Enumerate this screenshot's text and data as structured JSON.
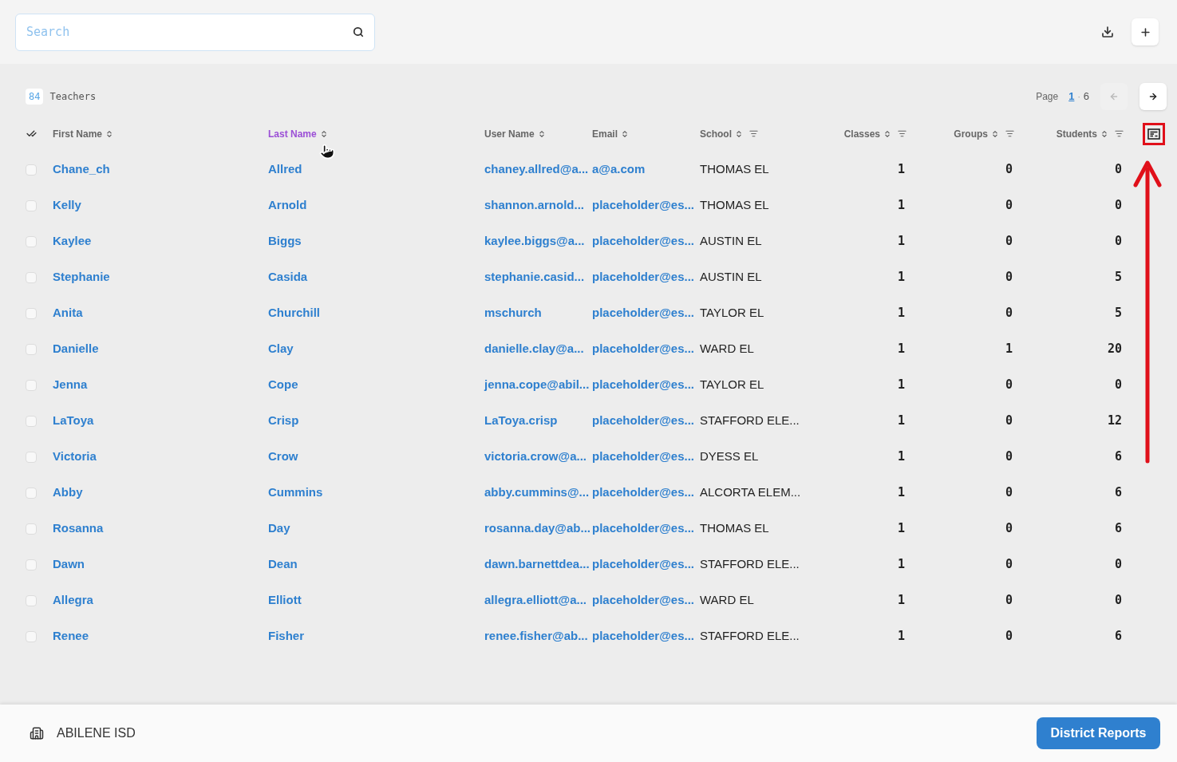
{
  "search": {
    "placeholder": "Search"
  },
  "summary": {
    "count": "84",
    "label": "Teachers"
  },
  "pagination": {
    "label": "Page",
    "current": "1",
    "separator": "·",
    "total": "6",
    "prev_disabled": true,
    "next_disabled": false
  },
  "columns": [
    {
      "label": "First Name",
      "kind": "text",
      "sortable": true,
      "filterable": false,
      "active": false
    },
    {
      "label": "Last Name",
      "kind": "text",
      "sortable": true,
      "filterable": false,
      "active": true
    },
    {
      "label": "User Name",
      "kind": "text",
      "sortable": true,
      "filterable": false,
      "active": false
    },
    {
      "label": "Email",
      "kind": "text",
      "sortable": true,
      "filterable": false,
      "active": false
    },
    {
      "label": "School",
      "kind": "plain",
      "sortable": true,
      "filterable": true,
      "active": false
    },
    {
      "label": "Classes",
      "kind": "number",
      "sortable": true,
      "filterable": true,
      "active": false
    },
    {
      "label": "Groups",
      "kind": "number",
      "sortable": true,
      "filterable": true,
      "active": false
    },
    {
      "label": "Students",
      "kind": "number",
      "sortable": true,
      "filterable": true,
      "active": false
    }
  ],
  "rows": [
    {
      "selected": false,
      "cells": [
        "Chane_ch",
        "Allred",
        "chaney.allred@a...",
        "a@a.com",
        "THOMAS EL",
        "1",
        "0",
        "0"
      ]
    },
    {
      "selected": false,
      "cells": [
        "Kelly",
        "Arnold",
        "shannon.arnold...",
        "placeholder@es...",
        "THOMAS EL",
        "1",
        "0",
        "0"
      ]
    },
    {
      "selected": false,
      "cells": [
        "Kaylee",
        "Biggs",
        "kaylee.biggs@a...",
        "placeholder@es...",
        "AUSTIN EL",
        "1",
        "0",
        "0"
      ]
    },
    {
      "selected": false,
      "cells": [
        "Stephanie",
        "Casida",
        "stephanie.casid...",
        "placeholder@es...",
        "AUSTIN EL",
        "1",
        "0",
        "5"
      ]
    },
    {
      "selected": false,
      "cells": [
        "Anita",
        "Churchill",
        "mschurch",
        "placeholder@es...",
        "TAYLOR EL",
        "1",
        "0",
        "5"
      ]
    },
    {
      "selected": false,
      "cells": [
        "Danielle",
        "Clay",
        "danielle.clay@a...",
        "placeholder@es...",
        "WARD EL",
        "1",
        "1",
        "20"
      ]
    },
    {
      "selected": false,
      "cells": [
        "Jenna",
        "Cope",
        "jenna.cope@abil...",
        "placeholder@es...",
        "TAYLOR EL",
        "1",
        "0",
        "0"
      ]
    },
    {
      "selected": false,
      "cells": [
        "LaToya",
        "Crisp",
        "LaToya.crisp",
        "placeholder@es...",
        "STAFFORD ELE...",
        "1",
        "0",
        "12"
      ]
    },
    {
      "selected": false,
      "cells": [
        "Victoria",
        "Crow",
        "victoria.crow@a...",
        "placeholder@es...",
        "DYESS EL",
        "1",
        "0",
        "6"
      ]
    },
    {
      "selected": false,
      "cells": [
        "Abby",
        "Cummins",
        "abby.cummins@...",
        "placeholder@es...",
        "ALCORTA ELEM...",
        "1",
        "0",
        "6"
      ]
    },
    {
      "selected": false,
      "cells": [
        "Rosanna",
        "Day",
        "rosanna.day@ab...",
        "placeholder@es...",
        "THOMAS EL",
        "1",
        "0",
        "6"
      ]
    },
    {
      "selected": false,
      "cells": [
        "Dawn",
        "Dean",
        "dawn.barnettdea...",
        "placeholder@es...",
        "STAFFORD ELE...",
        "1",
        "0",
        "0"
      ]
    },
    {
      "selected": false,
      "cells": [
        "Allegra",
        "Elliott",
        "allegra.elliott@a...",
        "placeholder@es...",
        "WARD EL",
        "1",
        "0",
        "0"
      ]
    },
    {
      "selected": false,
      "cells": [
        "Renee",
        "Fisher",
        "renee.fisher@ab...",
        "placeholder@es...",
        "STAFFORD ELE...",
        "1",
        "0",
        "6"
      ]
    }
  ],
  "footer": {
    "district": "ABILENE ISD",
    "button": "District Reports"
  }
}
